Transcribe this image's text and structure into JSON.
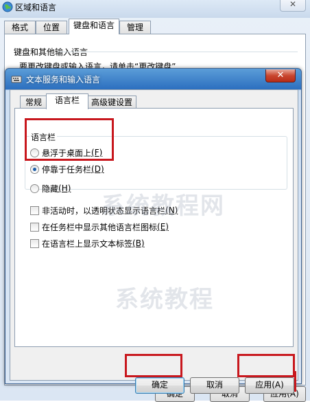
{
  "bg": {
    "title": "区域和语言",
    "close_label": "✕",
    "tabs": [
      "格式",
      "位置",
      "键盘和语言",
      "管理"
    ],
    "group_label": "键盘和其他输入语言",
    "desc": "要更改键盘或输入语言，请单击“更改键盘”",
    "ok_label": "确定",
    "cancel_label": "取消",
    "apply_label": "应用(A)"
  },
  "dialog": {
    "title": "文本服务和输入语言",
    "close_label": "✕",
    "tabs": [
      "常规",
      "语言栏",
      "高级键设置"
    ],
    "group_label": "语言栏",
    "radio_float": "悬浮于桌面上",
    "radio_float_key": "(F)",
    "radio_dock": "停靠于任务栏",
    "radio_dock_key": "(D)",
    "radio_hidden": "隐藏",
    "radio_hidden_key": "(H)",
    "check_transparent": "非活动时，以透明状态显示语言栏",
    "check_transparent_key": "(N)",
    "check_extra_icons": "在任务栏中显示其他语言栏图标",
    "check_extra_icons_key": "(E)",
    "check_text_labels": "在语言栏上显示文本标签",
    "check_text_labels_key": "(B)",
    "ok_label": "确定",
    "cancel_label": "取消",
    "apply_label": "应用(A)"
  },
  "state": {
    "selected_radio": "dock",
    "checks": [
      false,
      false,
      false
    ]
  },
  "watermark": [
    "系统教程网",
    "系统教程"
  ],
  "highlight_color": "#c8171d"
}
